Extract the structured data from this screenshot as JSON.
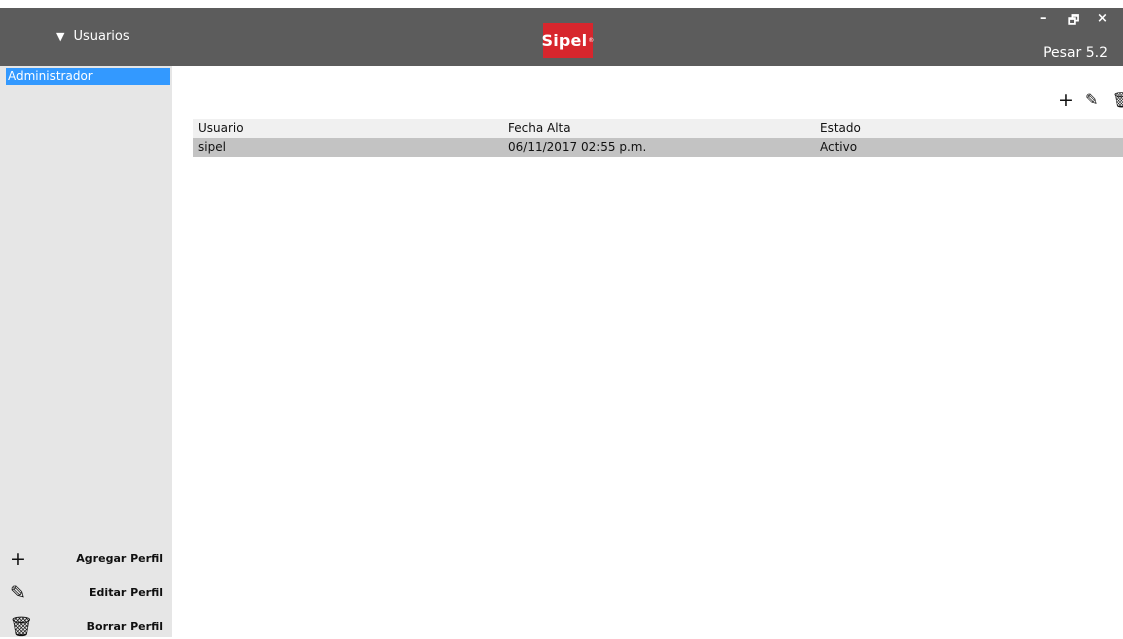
{
  "titlebar": {
    "nav_label": "Usuarios",
    "logo_text": "Sipel",
    "logo_mark": "®",
    "version": "Pesar 5.2",
    "controls": {
      "minimize": "–",
      "maximize": "🗗",
      "close": "×"
    }
  },
  "sidebar": {
    "profiles": [
      {
        "label": "Administrador",
        "selected": true
      }
    ],
    "actions": [
      {
        "icon": "plus-icon",
        "glyph": "+",
        "label": "Agregar Perfil"
      },
      {
        "icon": "pencil-icon",
        "glyph": "✎",
        "label": "Editar Perfil"
      },
      {
        "icon": "trash-icon",
        "glyph": "🗑",
        "label": "Borrar Perfil"
      }
    ]
  },
  "toolbar": {
    "add_glyph": "+",
    "edit_glyph": "✎",
    "delete_glyph": "🗑"
  },
  "table": {
    "columns": [
      "Usuario",
      "Fecha Alta",
      "Estado"
    ],
    "rows": [
      [
        "sipel",
        "06/11/2017 02:55 p.m.",
        "Activo"
      ]
    ]
  },
  "colors": {
    "titlebar": "#5c5c5c",
    "sidebar": "#e6e6e6",
    "selection": "#3399ff",
    "logo_red": "#d7262d",
    "selected_row": "#c3c3c3"
  }
}
